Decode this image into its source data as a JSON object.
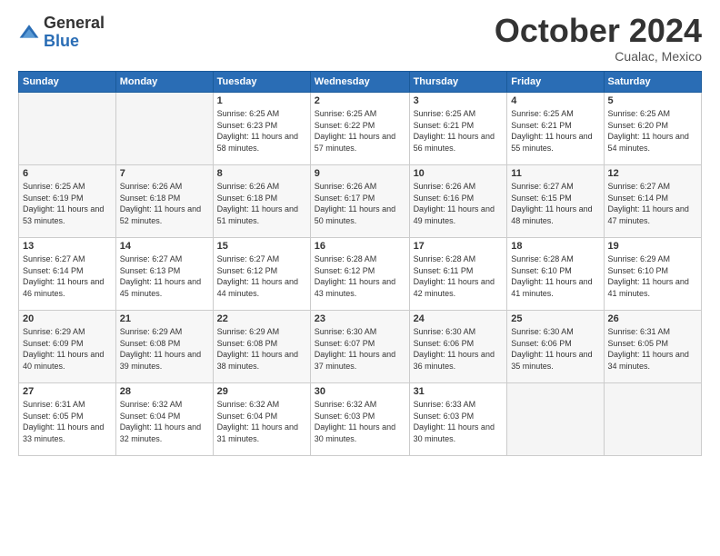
{
  "header": {
    "logo_general": "General",
    "logo_blue": "Blue",
    "month_title": "October 2024",
    "subtitle": "Cualac, Mexico"
  },
  "days_of_week": [
    "Sunday",
    "Monday",
    "Tuesday",
    "Wednesday",
    "Thursday",
    "Friday",
    "Saturday"
  ],
  "weeks": [
    [
      {
        "day": "",
        "info": ""
      },
      {
        "day": "",
        "info": ""
      },
      {
        "day": "1",
        "sunrise": "Sunrise: 6:25 AM",
        "sunset": "Sunset: 6:23 PM",
        "daylight": "Daylight: 11 hours and 58 minutes."
      },
      {
        "day": "2",
        "sunrise": "Sunrise: 6:25 AM",
        "sunset": "Sunset: 6:22 PM",
        "daylight": "Daylight: 11 hours and 57 minutes."
      },
      {
        "day": "3",
        "sunrise": "Sunrise: 6:25 AM",
        "sunset": "Sunset: 6:21 PM",
        "daylight": "Daylight: 11 hours and 56 minutes."
      },
      {
        "day": "4",
        "sunrise": "Sunrise: 6:25 AM",
        "sunset": "Sunset: 6:21 PM",
        "daylight": "Daylight: 11 hours and 55 minutes."
      },
      {
        "day": "5",
        "sunrise": "Sunrise: 6:25 AM",
        "sunset": "Sunset: 6:20 PM",
        "daylight": "Daylight: 11 hours and 54 minutes."
      }
    ],
    [
      {
        "day": "6",
        "sunrise": "Sunrise: 6:25 AM",
        "sunset": "Sunset: 6:19 PM",
        "daylight": "Daylight: 11 hours and 53 minutes."
      },
      {
        "day": "7",
        "sunrise": "Sunrise: 6:26 AM",
        "sunset": "Sunset: 6:18 PM",
        "daylight": "Daylight: 11 hours and 52 minutes."
      },
      {
        "day": "8",
        "sunrise": "Sunrise: 6:26 AM",
        "sunset": "Sunset: 6:18 PM",
        "daylight": "Daylight: 11 hours and 51 minutes."
      },
      {
        "day": "9",
        "sunrise": "Sunrise: 6:26 AM",
        "sunset": "Sunset: 6:17 PM",
        "daylight": "Daylight: 11 hours and 50 minutes."
      },
      {
        "day": "10",
        "sunrise": "Sunrise: 6:26 AM",
        "sunset": "Sunset: 6:16 PM",
        "daylight": "Daylight: 11 hours and 49 minutes."
      },
      {
        "day": "11",
        "sunrise": "Sunrise: 6:27 AM",
        "sunset": "Sunset: 6:15 PM",
        "daylight": "Daylight: 11 hours and 48 minutes."
      },
      {
        "day": "12",
        "sunrise": "Sunrise: 6:27 AM",
        "sunset": "Sunset: 6:14 PM",
        "daylight": "Daylight: 11 hours and 47 minutes."
      }
    ],
    [
      {
        "day": "13",
        "sunrise": "Sunrise: 6:27 AM",
        "sunset": "Sunset: 6:14 PM",
        "daylight": "Daylight: 11 hours and 46 minutes."
      },
      {
        "day": "14",
        "sunrise": "Sunrise: 6:27 AM",
        "sunset": "Sunset: 6:13 PM",
        "daylight": "Daylight: 11 hours and 45 minutes."
      },
      {
        "day": "15",
        "sunrise": "Sunrise: 6:27 AM",
        "sunset": "Sunset: 6:12 PM",
        "daylight": "Daylight: 11 hours and 44 minutes."
      },
      {
        "day": "16",
        "sunrise": "Sunrise: 6:28 AM",
        "sunset": "Sunset: 6:12 PM",
        "daylight": "Daylight: 11 hours and 43 minutes."
      },
      {
        "day": "17",
        "sunrise": "Sunrise: 6:28 AM",
        "sunset": "Sunset: 6:11 PM",
        "daylight": "Daylight: 11 hours and 42 minutes."
      },
      {
        "day": "18",
        "sunrise": "Sunrise: 6:28 AM",
        "sunset": "Sunset: 6:10 PM",
        "daylight": "Daylight: 11 hours and 41 minutes."
      },
      {
        "day": "19",
        "sunrise": "Sunrise: 6:29 AM",
        "sunset": "Sunset: 6:10 PM",
        "daylight": "Daylight: 11 hours and 41 minutes."
      }
    ],
    [
      {
        "day": "20",
        "sunrise": "Sunrise: 6:29 AM",
        "sunset": "Sunset: 6:09 PM",
        "daylight": "Daylight: 11 hours and 40 minutes."
      },
      {
        "day": "21",
        "sunrise": "Sunrise: 6:29 AM",
        "sunset": "Sunset: 6:08 PM",
        "daylight": "Daylight: 11 hours and 39 minutes."
      },
      {
        "day": "22",
        "sunrise": "Sunrise: 6:29 AM",
        "sunset": "Sunset: 6:08 PM",
        "daylight": "Daylight: 11 hours and 38 minutes."
      },
      {
        "day": "23",
        "sunrise": "Sunrise: 6:30 AM",
        "sunset": "Sunset: 6:07 PM",
        "daylight": "Daylight: 11 hours and 37 minutes."
      },
      {
        "day": "24",
        "sunrise": "Sunrise: 6:30 AM",
        "sunset": "Sunset: 6:06 PM",
        "daylight": "Daylight: 11 hours and 36 minutes."
      },
      {
        "day": "25",
        "sunrise": "Sunrise: 6:30 AM",
        "sunset": "Sunset: 6:06 PM",
        "daylight": "Daylight: 11 hours and 35 minutes."
      },
      {
        "day": "26",
        "sunrise": "Sunrise: 6:31 AM",
        "sunset": "Sunset: 6:05 PM",
        "daylight": "Daylight: 11 hours and 34 minutes."
      }
    ],
    [
      {
        "day": "27",
        "sunrise": "Sunrise: 6:31 AM",
        "sunset": "Sunset: 6:05 PM",
        "daylight": "Daylight: 11 hours and 33 minutes."
      },
      {
        "day": "28",
        "sunrise": "Sunrise: 6:32 AM",
        "sunset": "Sunset: 6:04 PM",
        "daylight": "Daylight: 11 hours and 32 minutes."
      },
      {
        "day": "29",
        "sunrise": "Sunrise: 6:32 AM",
        "sunset": "Sunset: 6:04 PM",
        "daylight": "Daylight: 11 hours and 31 minutes."
      },
      {
        "day": "30",
        "sunrise": "Sunrise: 6:32 AM",
        "sunset": "Sunset: 6:03 PM",
        "daylight": "Daylight: 11 hours and 30 minutes."
      },
      {
        "day": "31",
        "sunrise": "Sunrise: 6:33 AM",
        "sunset": "Sunset: 6:03 PM",
        "daylight": "Daylight: 11 hours and 30 minutes."
      },
      {
        "day": "",
        "info": ""
      },
      {
        "day": "",
        "info": ""
      }
    ]
  ]
}
